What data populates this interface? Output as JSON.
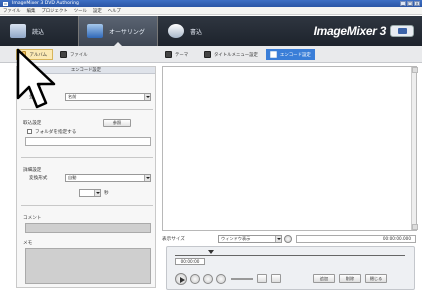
{
  "window": {
    "title": "ImageMixer 3 DVD Authoring"
  },
  "menu": [
    "ファイル",
    "編集",
    "プロジェクト",
    "ツール",
    "設定",
    "ヘルプ"
  ],
  "nav": {
    "tabs": [
      {
        "label": "読込",
        "icon": "import-icon"
      },
      {
        "label": "オーサリング",
        "icon": "authoring-icon",
        "active": true
      },
      {
        "label": "書込",
        "icon": "write-icon"
      }
    ],
    "brand": "ImageMixer 3"
  },
  "toolbar": {
    "item1": "アルバム",
    "item2": "ファイル",
    "item3": "テーマ",
    "item4": "タイトルメニュー設定",
    "item5": "エンコード設定"
  },
  "left": {
    "header": "エンコード設定",
    "display_section": "表示方法",
    "display_label": "並び順",
    "display_value": "名前",
    "capture_section": "取込設定",
    "capture_button": "参照",
    "capture_checkbox": "フォルダを指定する",
    "encode_section": "詳細設定",
    "encode_label": "変換形式",
    "encode_value": "自動",
    "encode_unit": "秒",
    "comment_label": "コメント",
    "memo_label": "メモ"
  },
  "player": {
    "display_label": "表示サイズ",
    "display_value": "ウィンドウ表示",
    "counter": "00:00:00.000",
    "timecode": "00:00:00",
    "buttons": [
      "追加",
      "削除",
      "閉じる"
    ]
  }
}
